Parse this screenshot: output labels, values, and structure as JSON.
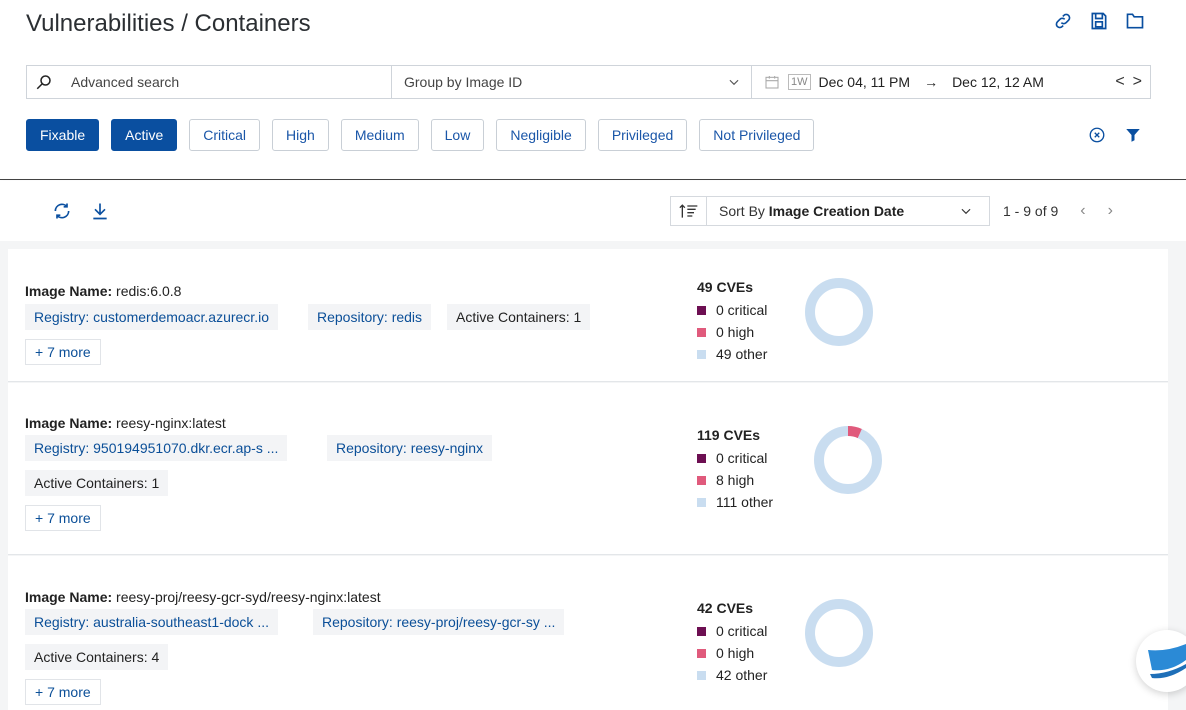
{
  "title": "Vulnerabilities / Containers",
  "search": {
    "placeholder": "Advanced search"
  },
  "group_by": "Group by Image ID",
  "date_range": {
    "preset": "1W",
    "start": "Dec 04, 11 PM",
    "arrow": "→",
    "end": "Dec 12, 12 AM",
    "prev": "<",
    "next": ">"
  },
  "filters": [
    {
      "label": "Fixable",
      "active": true
    },
    {
      "label": "Active",
      "active": true
    },
    {
      "label": "Critical",
      "active": false
    },
    {
      "label": "High",
      "active": false
    },
    {
      "label": "Medium",
      "active": false
    },
    {
      "label": "Low",
      "active": false
    },
    {
      "label": "Negligible",
      "active": false
    },
    {
      "label": "Privileged",
      "active": false
    },
    {
      "label": "Not Privileged",
      "active": false
    }
  ],
  "sort": {
    "prefix": "Sort By",
    "field": "Image Creation Date"
  },
  "pagination": {
    "text": "1 - 9 of 9",
    "prev": "‹",
    "next": "›"
  },
  "colors": {
    "critical": "#6d0f52",
    "high": "#e05a7c",
    "other": "#c9ddf0",
    "primary": "#0a4fa0"
  },
  "images": [
    {
      "name_label": "Image Name:",
      "name": "redis:6.0.8",
      "registry": "Registry: customerdemoacr.azurecr.io",
      "repository": "Repository: redis",
      "active_containers": "Active Containers: 1",
      "more": "+ 7 more",
      "cves_total": "49 CVEs",
      "critical_label": "0 critical",
      "high_label": "0 high",
      "other_label": "49 other",
      "critical": 0,
      "high": 0,
      "other": 49
    },
    {
      "name_label": "Image Name:",
      "name": "reesy-nginx:latest",
      "registry": "Registry: 950194951070.dkr.ecr.ap-s ...",
      "repository": "Repository: reesy-nginx",
      "active_containers": "Active Containers: 1",
      "more": "+ 7 more",
      "cves_total": "119 CVEs",
      "critical_label": "0 critical",
      "high_label": "8 high",
      "other_label": "111 other",
      "critical": 0,
      "high": 8,
      "other": 111
    },
    {
      "name_label": "Image Name:",
      "name": "reesy-proj/reesy-gcr-syd/reesy-nginx:latest",
      "registry": "Registry: australia-southeast1-dock ...",
      "repository": "Repository: reesy-proj/reesy-gcr-sy ...",
      "active_containers": "Active Containers: 4",
      "more": "+ 7 more",
      "cves_total": "42 CVEs",
      "critical_label": "0 critical",
      "high_label": "0 high",
      "other_label": "42 other",
      "critical": 0,
      "high": 0,
      "other": 42
    }
  ]
}
